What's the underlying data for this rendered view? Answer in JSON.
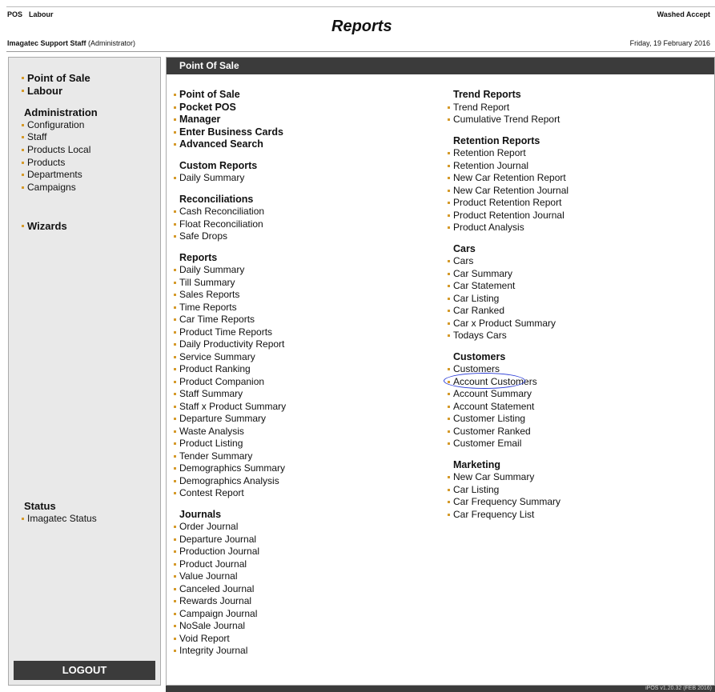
{
  "topnav": {
    "pos": "POS",
    "labour": "Labour"
  },
  "brand_right": "Washed Accept",
  "page_title": "Reports",
  "user": {
    "name": "Imagatec Support Staff",
    "role": "(Administrator)"
  },
  "date": "Friday, 19 February 2016",
  "sidebar": {
    "top_links": [
      "Point of Sale",
      "Labour"
    ],
    "admin_heading": "Administration",
    "admin_links": [
      "Configuration",
      "Staff",
      "Products Local",
      "Products",
      "Departments",
      "Campaigns"
    ],
    "wizards": "Wizards",
    "status_heading": "Status",
    "status_link": "Imagatec Status",
    "logout": "LOGOUT"
  },
  "main": {
    "header": "Point Of Sale",
    "left": {
      "main_links": [
        "Point of Sale",
        "Pocket POS",
        "Manager",
        "Enter Business Cards",
        "Advanced Search"
      ],
      "custom_reports": {
        "title": "Custom Reports",
        "items": [
          "Daily Summary"
        ]
      },
      "reconciliations": {
        "title": "Reconciliations",
        "items": [
          "Cash Reconciliation",
          "Float Reconciliation",
          "Safe Drops"
        ]
      },
      "reports": {
        "title": "Reports",
        "items": [
          "Daily Summary",
          "Till Summary",
          "Sales Reports",
          "Time Reports",
          "Car Time Reports",
          "Product Time Reports",
          "Daily Productivity Report",
          "Service Summary",
          "Product Ranking",
          "Product Companion",
          "Staff Summary",
          "Staff x Product Summary",
          "Departure Summary",
          "Waste Analysis",
          "Product Listing",
          "Tender Summary",
          "Demographics Summary",
          "Demographics Analysis",
          "Contest Report"
        ]
      },
      "journals": {
        "title": "Journals",
        "items": [
          "Order Journal",
          "Departure Journal",
          "Production Journal",
          "Product Journal",
          "Value Journal",
          "Canceled Journal",
          "Rewards Journal",
          "Campaign Journal",
          "NoSale Journal",
          "Void Report",
          "Integrity Journal"
        ]
      }
    },
    "right": {
      "trend": {
        "title": "Trend Reports",
        "items": [
          "Trend Report",
          "Cumulative Trend Report"
        ]
      },
      "retention": {
        "title": "Retention Reports",
        "items": [
          "Retention Report",
          "Retention Journal",
          "New Car Retention Report",
          "New Car Retention Journal",
          "Product Retention Report",
          "Product Retention Journal",
          "Product Analysis"
        ]
      },
      "cars": {
        "title": "Cars",
        "items": [
          "Cars",
          "Car Summary",
          "Car Statement",
          "Car Listing",
          "Car Ranked",
          "Car x Product Summary",
          "Todays Cars"
        ]
      },
      "customers": {
        "title": "Customers",
        "items": [
          "Customers",
          "Account Customers",
          "Account Summary",
          "Account Statement",
          "Customer Listing",
          "Customer Ranked",
          "Customer Email"
        ]
      },
      "marketing": {
        "title": "Marketing",
        "items": [
          "New Car Summary",
          "Car Listing",
          "Car Frequency Summary",
          "Car Frequency List"
        ]
      }
    }
  },
  "footer": "iPOS v1.20.32 (FEB 2016)"
}
